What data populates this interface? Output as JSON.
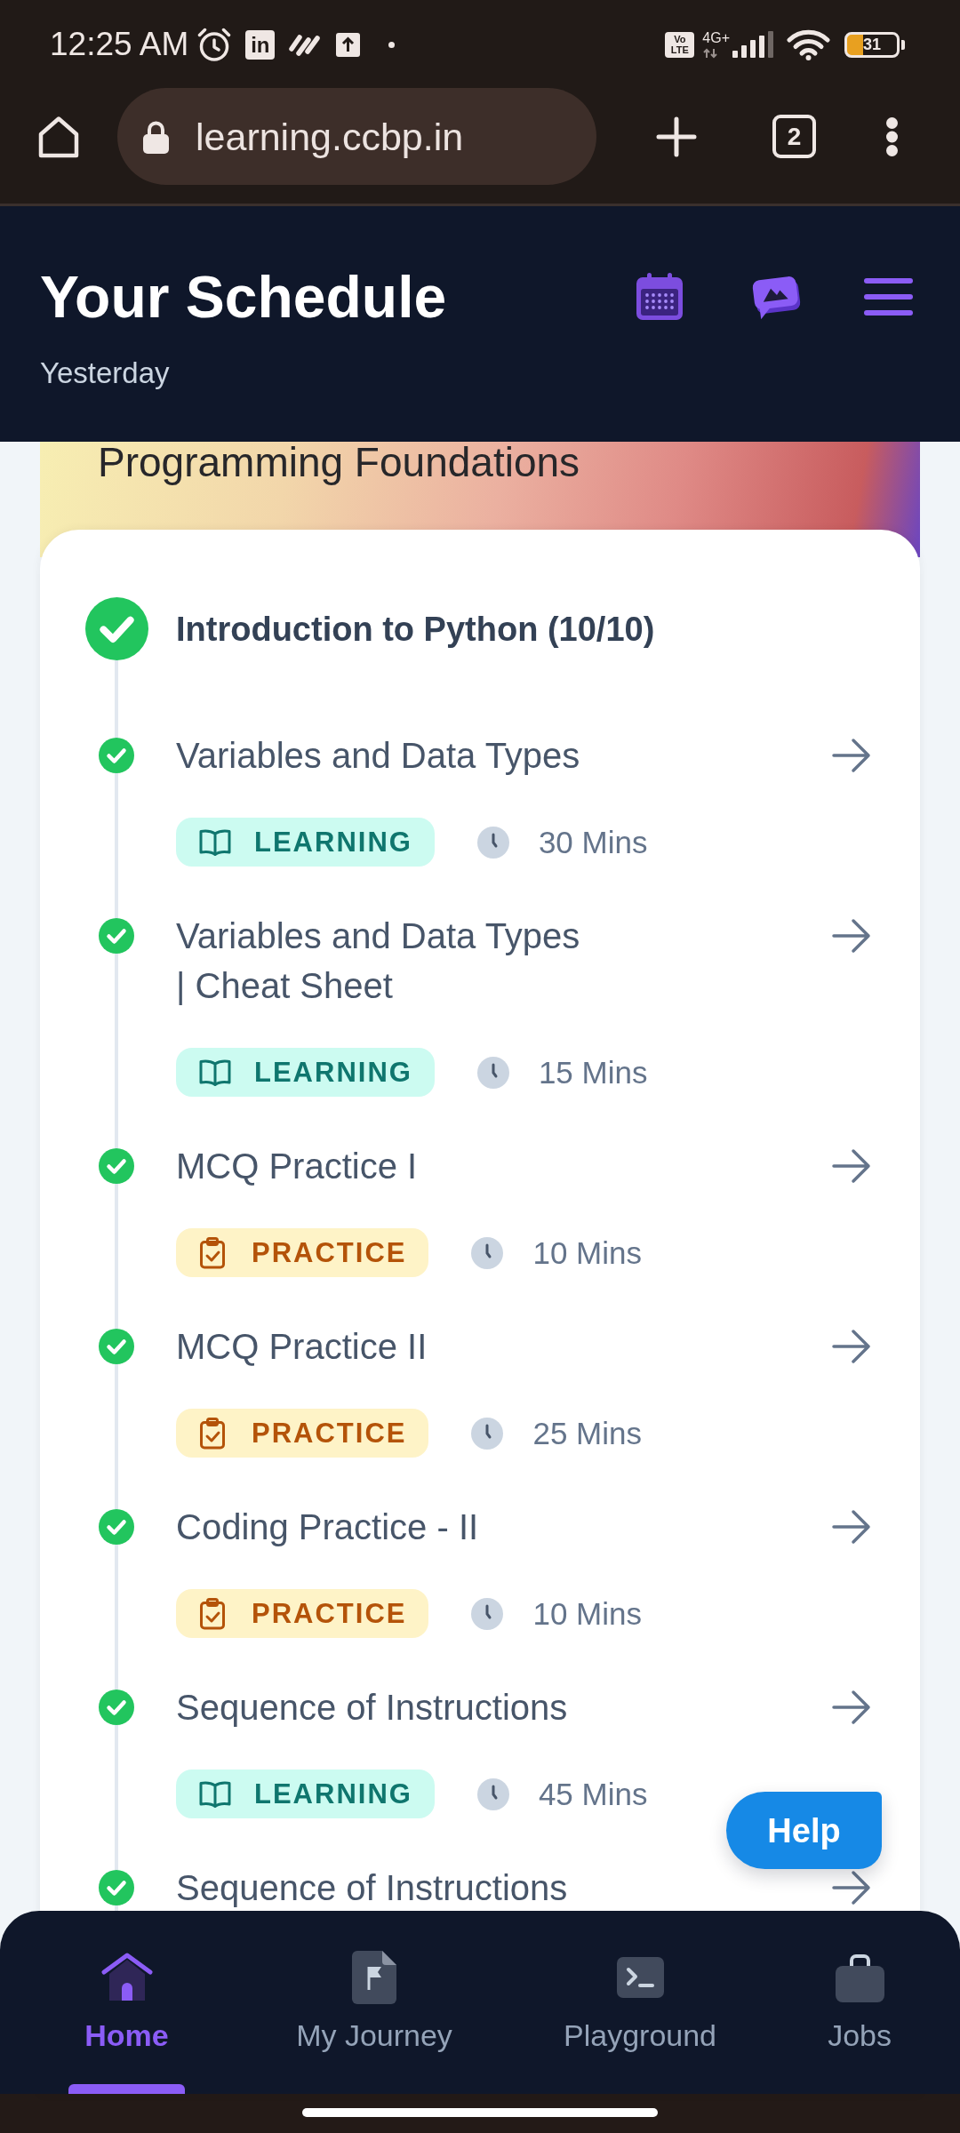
{
  "status_bar": {
    "time": "12:25 AM",
    "app_icon_label": "in",
    "volte_label": [
      "Vo",
      "LTE"
    ],
    "network_type": "4G+",
    "battery": "31"
  },
  "browser_toolbar": {
    "url": "learning.ccbp.in",
    "tab_count": "2"
  },
  "header": {
    "title": "Your Schedule",
    "subtitle": "Yesterday"
  },
  "course": {
    "title": "Programming Foundations"
  },
  "module": {
    "title": "Introduction to Python (10/10)",
    "completed": true,
    "items": [
      {
        "title": "Variables and Data Types",
        "completed": true,
        "kind": "learning",
        "tag": "LEARNING",
        "duration": "30 Mins"
      },
      {
        "title": "Variables and Data Types\n| Cheat Sheet",
        "completed": true,
        "kind": "learning",
        "tag": "LEARNING",
        "duration": "15 Mins"
      },
      {
        "title": "MCQ Practice I",
        "completed": true,
        "kind": "practice",
        "tag": "PRACTICE",
        "duration": "10 Mins"
      },
      {
        "title": "MCQ Practice II",
        "completed": true,
        "kind": "practice",
        "tag": "PRACTICE",
        "duration": "25 Mins"
      },
      {
        "title": "Coding Practice - II",
        "completed": true,
        "kind": "practice",
        "tag": "PRACTICE",
        "duration": "10 Mins"
      },
      {
        "title": "Sequence of Instructions",
        "completed": true,
        "kind": "learning",
        "tag": "LEARNING",
        "duration": "45 Mins"
      },
      {
        "title": "Sequence of Instructions",
        "completed": true
      }
    ]
  },
  "help_button": {
    "label": "Help"
  },
  "bottom_nav": {
    "items": [
      {
        "label": "Home",
        "selected": true
      },
      {
        "label": "My Journey",
        "selected": false
      },
      {
        "label": "Playground",
        "selected": false
      },
      {
        "label": "Jobs",
        "selected": false
      }
    ]
  }
}
